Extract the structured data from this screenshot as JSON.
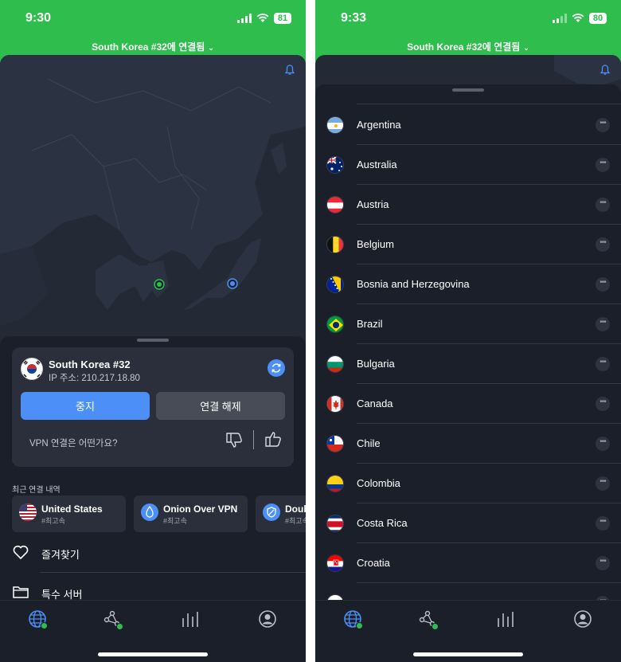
{
  "left": {
    "status": {
      "time": "9:30",
      "battery": "81"
    },
    "connection_title": "South Korea #32에 연결됨",
    "server": {
      "name": "South Korea #32",
      "ip": "IP 주소: 210.217.18.80"
    },
    "buttons": {
      "stop": "중지",
      "disconnect": "연결 해제"
    },
    "feedback_prompt": "VPN 연결은 어떤가요?",
    "recent_label": "최근 연결 내역",
    "recent": [
      {
        "name": "United States",
        "sub": "#최고속"
      },
      {
        "name": "Onion Over VPN",
        "sub": "#최고속"
      },
      {
        "name": "Doub",
        "sub": "#최고속"
      }
    ],
    "menu": [
      {
        "label": "즐겨찾기"
      },
      {
        "label": "특수 서버"
      }
    ]
  },
  "right": {
    "status": {
      "time": "9:33",
      "battery": "80"
    },
    "connection_title": "South Korea #32에 연결됨",
    "countries": [
      {
        "name": "Argentina",
        "flag": "argentina"
      },
      {
        "name": "Australia",
        "flag": "australia"
      },
      {
        "name": "Austria",
        "flag": "austria"
      },
      {
        "name": "Belgium",
        "flag": "belgium"
      },
      {
        "name": "Bosnia and Herzegovina",
        "flag": "bosnia"
      },
      {
        "name": "Brazil",
        "flag": "brazil"
      },
      {
        "name": "Bulgaria",
        "flag": "bulgaria"
      },
      {
        "name": "Canada",
        "flag": "canada"
      },
      {
        "name": "Chile",
        "flag": "chile"
      },
      {
        "name": "Colombia",
        "flag": "colombia"
      },
      {
        "name": "Costa Rica",
        "flag": "costa-rica"
      },
      {
        "name": "Croatia",
        "flag": "croatia"
      }
    ],
    "more_glyph": "•••"
  },
  "tabs": [
    {
      "icon": "globe-icon"
    },
    {
      "icon": "meshnet-icon"
    },
    {
      "icon": "stats-icon"
    },
    {
      "icon": "profile-icon"
    }
  ],
  "colors": {
    "brand_green": "#2fbd4e",
    "accent_blue": "#4b8ff7",
    "surface": "#1b1f2a",
    "card": "#2a2f3b"
  }
}
